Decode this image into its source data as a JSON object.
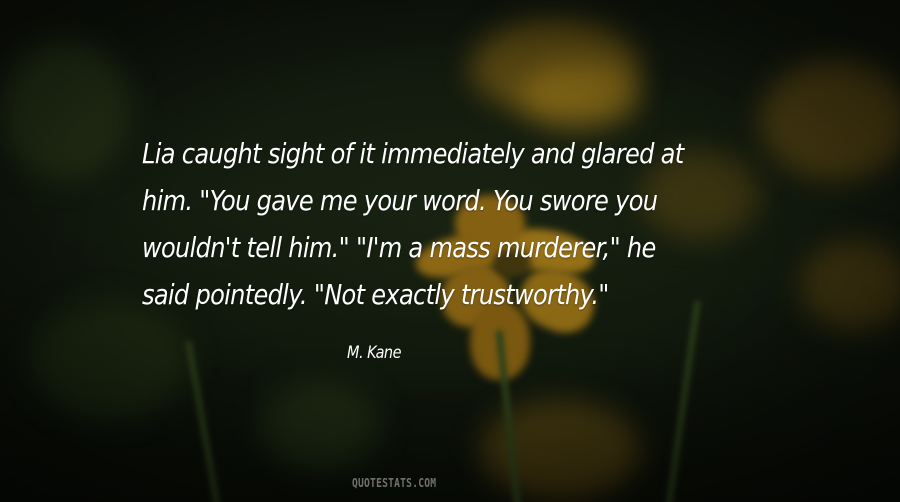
{
  "quote": {
    "lines": [
      "Lia caught sight of it immediately and glared at",
      "him. \"You gave me your word. You swore you",
      "wouldn't tell him.\" \"I'm a mass murderer,\" he",
      "said pointedly. \"Not exactly trustworthy.\""
    ],
    "author": "M. Kane"
  },
  "watermark": "QUOTESTATS.COM",
  "colors": {
    "background": "#24321a",
    "flower": "#c99a1e",
    "text": "#ffffff"
  }
}
